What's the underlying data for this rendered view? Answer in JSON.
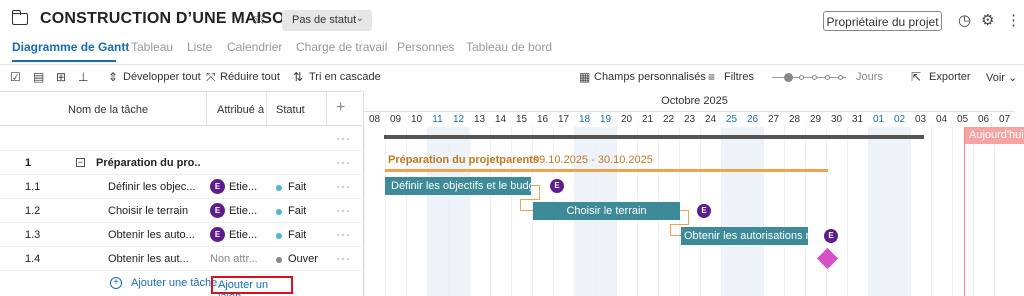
{
  "header": {
    "title": "CONSTRUCTION D’UNE MAISON",
    "status": "Pas de statut",
    "owner_button": "Propriétaire du projet"
  },
  "tabs": [
    {
      "label": "Diagramme de Gantt",
      "active": true
    },
    {
      "label": "Tableau"
    },
    {
      "label": "Liste"
    },
    {
      "label": "Calendrier"
    },
    {
      "label": "Charge de travail"
    },
    {
      "label": "Personnes"
    },
    {
      "label": "Tableau de bord"
    }
  ],
  "toolbar": {
    "expand_all": "Développer tout",
    "collapse_all": "Réduire tout",
    "cascade_sort": "Tri en cascade",
    "custom_fields": "Champs personnalisés",
    "filters": "Filtres",
    "zoom_label": "Jours",
    "export": "Exporter",
    "view": "Voir"
  },
  "grid": {
    "col_name": "Nom de la tâche",
    "col_assigned": "Attribué à",
    "col_status": "Statut",
    "rows": [
      {
        "num": "1",
        "name": "Préparation du pro...",
        "assigned": "",
        "status": "",
        "is_group": true
      },
      {
        "num": "1.1",
        "name": "Définir les objec...",
        "assignee_initial": "E",
        "assigned": "Etie...",
        "status": "Fait",
        "status_color": "#4fb6d6"
      },
      {
        "num": "1.2",
        "name": "Choisir le terrain",
        "assignee_initial": "E",
        "assigned": "Etie...",
        "status": "Fait",
        "status_color": "#4fb6d6"
      },
      {
        "num": "1.3",
        "name": "Obtenir les auto...",
        "assignee_initial": "E",
        "assigned": "Etie...",
        "status": "Fait",
        "status_color": "#4fb6d6"
      },
      {
        "num": "1.4",
        "name": "Obtenir les aut...",
        "assigned": "Non attr...",
        "status": "Ouver",
        "status_color": "#888888"
      }
    ],
    "add_task": "Ajouter une tâche",
    "add_milestone": "Ajouter un jalon"
  },
  "gantt": {
    "month": "Octobre 2025",
    "days": [
      "08",
      "09",
      "10",
      "11",
      "12",
      "13",
      "14",
      "15",
      "16",
      "17",
      "18",
      "19",
      "20",
      "21",
      "22",
      "23",
      "24",
      "25",
      "26",
      "27",
      "28",
      "29",
      "30",
      "31",
      "01",
      "02",
      "03",
      "04",
      "05",
      "06",
      "07"
    ],
    "weekend_days": [
      "11",
      "12",
      "18",
      "19",
      "25",
      "26",
      "01",
      "02"
    ],
    "today_label": "Aujourd'hui",
    "summary_label": "Préparation du projetparents",
    "summary_dates": "09.10.2025 - 30.10.2025",
    "tasks": [
      {
        "label": "Définir les objectifs et le budget",
        "avatar": "E"
      },
      {
        "label": "Choisir le terrain",
        "avatar": "E"
      },
      {
        "label": "Obtenir les autorisations n...",
        "avatar": "E"
      }
    ],
    "milestone_avatar": "E"
  }
}
